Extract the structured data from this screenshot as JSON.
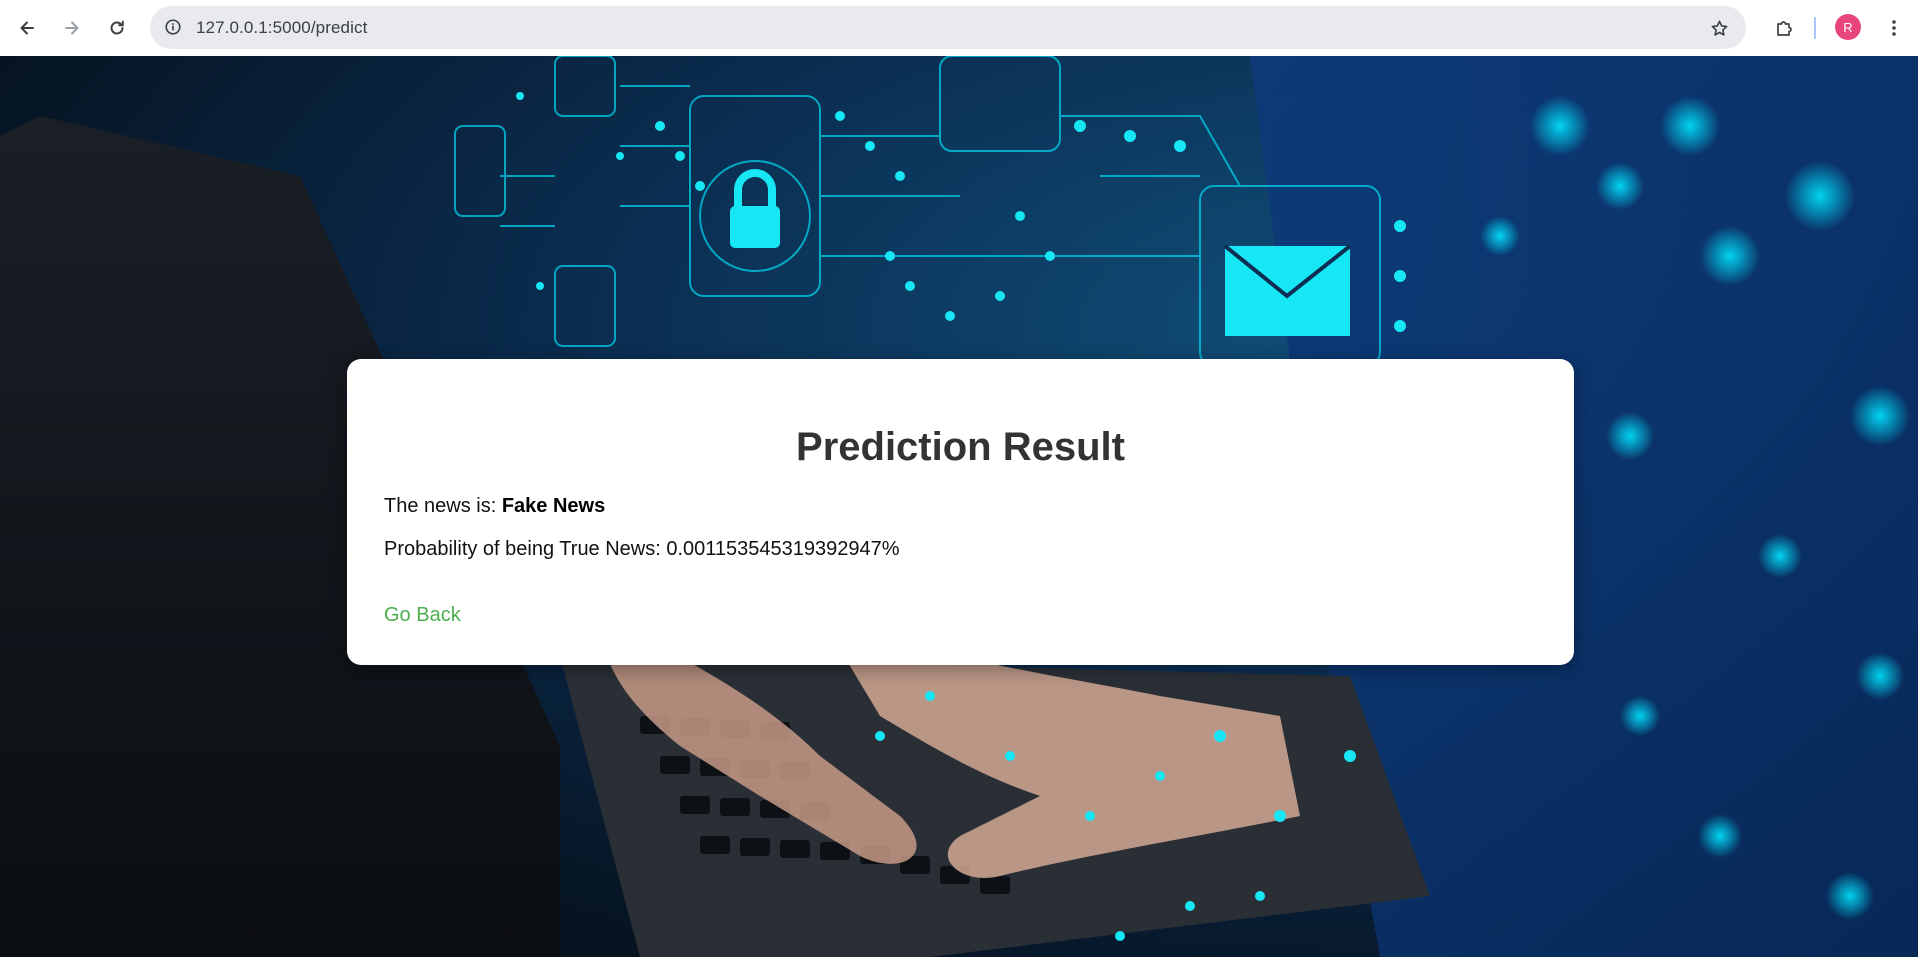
{
  "browser": {
    "url": "127.0.0.1:5000/predict",
    "profile_initial": "R",
    "icons": {
      "back": "arrow-left-icon",
      "forward": "arrow-right-icon",
      "reload": "reload-icon",
      "info": "info-icon",
      "bookmark": "star-icon",
      "extensions": "puzzle-icon",
      "menu": "kebab-menu-icon"
    }
  },
  "page": {
    "title": "Prediction Result",
    "result_prefix": "The news is: ",
    "result_value": "Fake News",
    "probability_text": "Probability of being True News: 0.001153545319392947%",
    "go_back_label": "Go Back"
  },
  "colors": {
    "link": "#4caf50",
    "title": "#333333",
    "avatar": "#e8457c",
    "background_glow": "#00e5ff"
  }
}
